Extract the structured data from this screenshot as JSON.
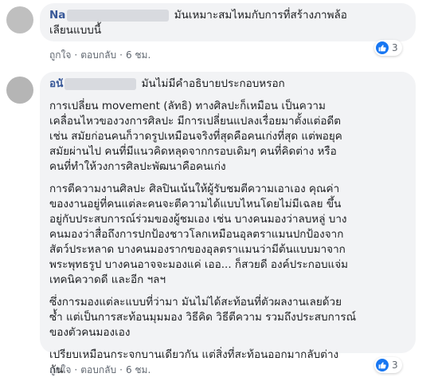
{
  "comment1": {
    "name": "Na",
    "text_line1": "มันเหมาะสมไหมกับการที่สร้างภาพล้อ",
    "text_line2": "เลียนแบบนี้",
    "like_label": "ถูกใจ",
    "reply_label": "ตอบกลับ",
    "time": "6 ชม.",
    "reaction_icon": "like-icon",
    "reaction_count": "3"
  },
  "comment2": {
    "name": "อนั",
    "header_text": "มันไม่มีคำอธิบายประกอบหรอก",
    "paragraphs": [
      [
        "การเปลี่ยน movement (ลัทธิ) ทางศิลปะก็เหมือน เป็นความ",
        "เคลื่อนไหวของวงการศิลปะ มีการเปลี่ยนแปลงเรื่อยมาตั้งแต่อดีต",
        "เช่น สมัยก่อนคนก็วาดรูปเหมือนจริงที่สุดคือคนเก่งที่สุด แต่พอยุค",
        "สมัยผ่านไป คนที่มีแนวคิดหลุดจากกรอบเดิมๆ คนที่คิดต่าง หรือ",
        "คนที่ทำให้วงการศิลปะพัฒนาคือคนเก่ง"
      ],
      [
        "การตีความงานศิลปะ ศิลปินเน้นให้ผู้รับชมตีความเอาเอง คุณค่า",
        "ของงานอยู่ที่คนแต่ละคนจะตีความได้แบบไหนโดยไม่มีเฉลย ขึ้น",
        "อยู่กับประสบการณ์ร่วมของผู้ชมเอง เช่น บางคนมองว่าลบหลู่ บาง",
        "คนมองว่าสื่อถึงการปกป้องชาวโลกเหมือนอุลตราแมนปกป้องจาก",
        "สัตว์ประหลาด บางคนมองรากของอุลตราแมนว่ามีต้นแบบมาจาก",
        "พระพุทธรูป บางคนอาจจะมองแค่ เออ... ก็สวยดี องค์ประกอบแจ่ม",
        "เทคนิควาดดี และอีก ฯลฯ"
      ],
      [
        "ซึ่งการมองแต่ละแบบที่ว่ามา มันไม่ได้สะท้อนที่ตัวผลงานเลยด้วย",
        "ซ้ำ แต่เป็นการสะท้อนมุมมอง วิธีคิด วิธีตีความ รวมถึงประสบการณ์",
        "ของตัวคนมองเอง"
      ],
      [
        "เปรียบเหมือนกระจกบานเดียวกัน แต่สิ่งที่สะท้อนออกมากลับต่าง",
        "กัน"
      ]
    ],
    "like_label": "ถูกใจ",
    "reply_label": "ตอบกลับ",
    "time": "6 ชม.",
    "reaction_icon": "like-icon",
    "reaction_count": "3"
  },
  "colors": {
    "bubble": "#f2f3f5",
    "name": "#385898",
    "meta": "#606770",
    "like": "#1877f2"
  }
}
